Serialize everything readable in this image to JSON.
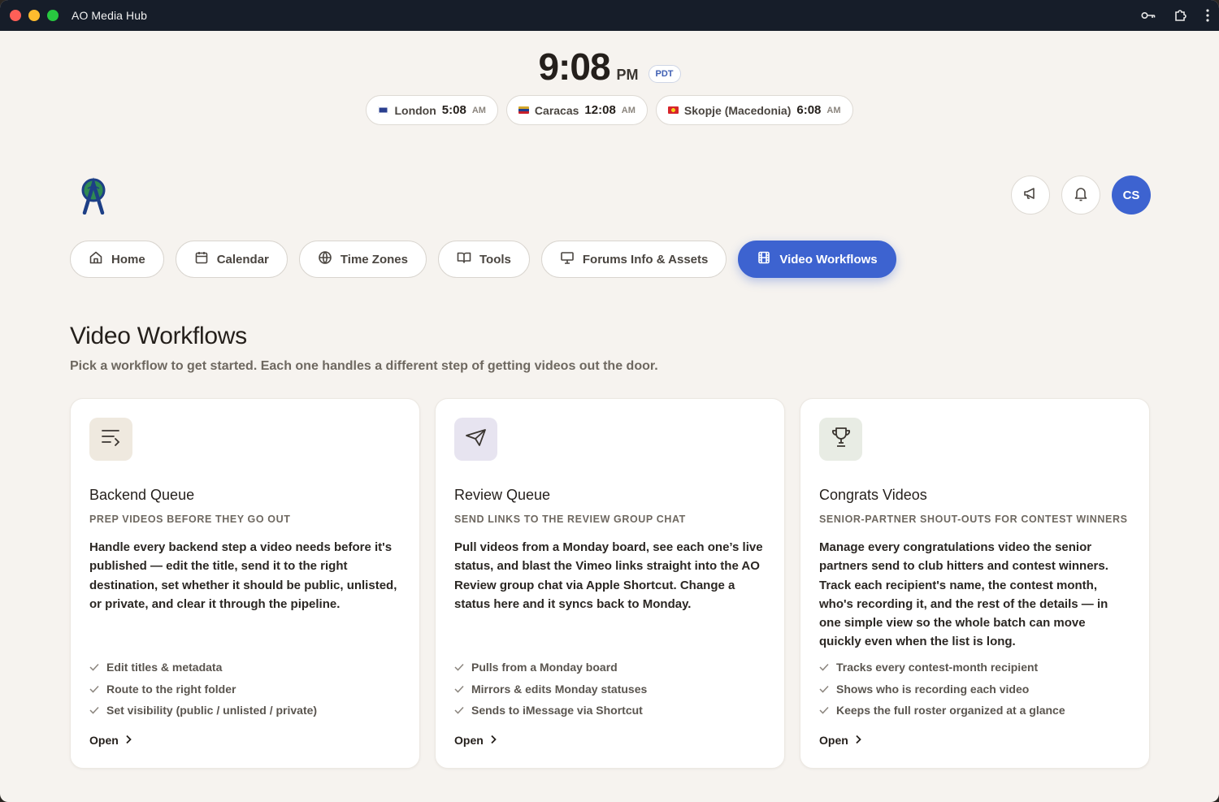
{
  "window": {
    "title": "AO Media Hub"
  },
  "clock": {
    "time": "9:08",
    "ampm": "PM",
    "timezone": "PDT"
  },
  "zones": [
    {
      "city": "London",
      "time": "5:08",
      "ampm": "AM",
      "flag_color": "#2a3f8f"
    },
    {
      "city": "Caracas",
      "time": "12:08",
      "ampm": "AM",
      "flag_color": "#d4a62a"
    },
    {
      "city": "Skopje (Macedonia)",
      "time": "6:08",
      "ampm": "AM",
      "flag_color": "#d6242b"
    }
  ],
  "header": {
    "avatar_initials": "CS",
    "accent": "#3d63d0"
  },
  "nav": [
    {
      "label": "Home",
      "icon": "home-icon"
    },
    {
      "label": "Calendar",
      "icon": "calendar-icon"
    },
    {
      "label": "Time Zones",
      "icon": "globe-icon"
    },
    {
      "label": "Tools",
      "icon": "book-icon"
    },
    {
      "label": "Forums Info & Assets",
      "icon": "presentation-icon"
    },
    {
      "label": "Video Workflows",
      "icon": "film-icon",
      "active": true
    }
  ],
  "page": {
    "title": "Video Workflows",
    "subtitle": "Pick a workflow to get started. Each one handles a different step of getting videos out the door."
  },
  "cards": [
    {
      "title": "Backend Queue",
      "kicker": "Prep videos before they go out",
      "description": "Handle every backend step a video needs before it's published — edit the title, send it to the right destination, set whether it should be public, unlisted, or private, and clear it through the pipeline.",
      "features": [
        "Edit titles & metadata",
        "Route to the right folder",
        "Set visibility (public / unlisted / private)"
      ],
      "open_label": "Open",
      "icon": "list-arrow-icon",
      "icon_bg": "#efe9df"
    },
    {
      "title": "Review Queue",
      "kicker": "Send links to the review group chat",
      "description": "Pull videos from a Monday board, see each one’s live status, and blast the Vimeo links straight into the AO Review group chat via Apple Shortcut. Change a status here and it syncs back to Monday.",
      "features": [
        "Pulls from a Monday board",
        "Mirrors & edits Monday statuses",
        "Sends to iMessage via Shortcut"
      ],
      "open_label": "Open",
      "icon": "send-icon",
      "icon_bg": "#e7e4f0"
    },
    {
      "title": "Congrats Videos",
      "kicker": "Senior-partner shout-outs for contest winners",
      "description": "Manage every congratulations video the senior partners send to club hitters and contest winners. Track each recipient's name, the contest month, who's recording it, and the rest of the details — in one simple view so the whole batch can move quickly even when the list is long.",
      "features": [
        "Tracks every contest-month recipient",
        "Shows who is recording each video",
        "Keeps the full roster organized at a glance"
      ],
      "open_label": "Open",
      "icon": "trophy-icon",
      "icon_bg": "#e8ece4"
    }
  ]
}
